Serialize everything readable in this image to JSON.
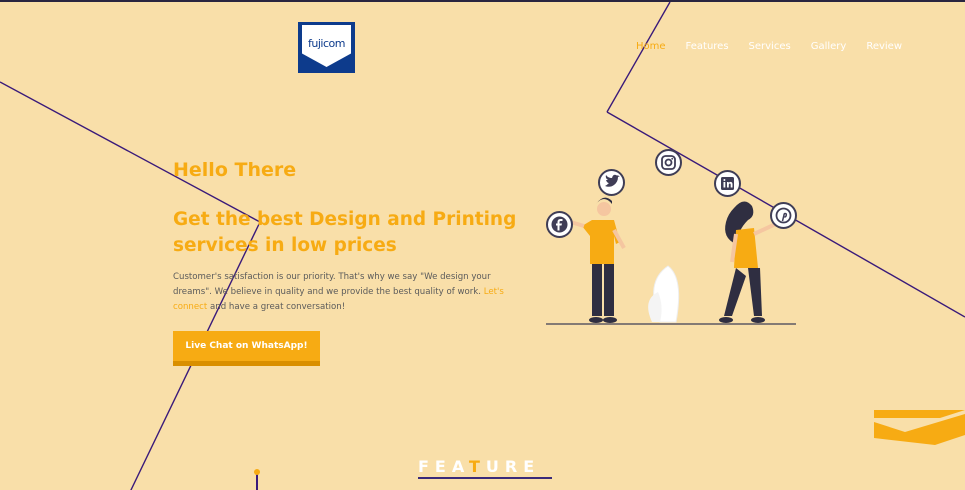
{
  "brand": {
    "logo_text": "fujicom"
  },
  "nav": {
    "items": [
      {
        "label": "Home",
        "active": true
      },
      {
        "label": "Features",
        "active": false
      },
      {
        "label": "Services",
        "active": false
      },
      {
        "label": "Gallery",
        "active": false
      },
      {
        "label": "Review",
        "active": false
      }
    ]
  },
  "hero": {
    "greeting": "Hello There",
    "headline": "Get the best Design and Printing services in low prices",
    "description_before_link": "Customer's satisfaction is our priority. That's why we say \"We design your dreams\". We believe in quality and we provide the best quality of work. ",
    "description_link": "Let's connect",
    "description_after_link": " and have a great conversation!",
    "cta_label": "Live Chat on WhatsApp!"
  },
  "section": {
    "feature_title_start": "FEA",
    "feature_title_mid": "T",
    "feature_title_end": "URE"
  },
  "illustration": {
    "social_icons": [
      "facebook-icon",
      "twitter-icon",
      "instagram-icon",
      "linkedin-icon",
      "pinterest-icon"
    ]
  },
  "colors": {
    "background": "#f9dfa9",
    "accent": "#f7ab13",
    "line": "#3a1a7a",
    "logo_blue": "#0d3b8c"
  }
}
